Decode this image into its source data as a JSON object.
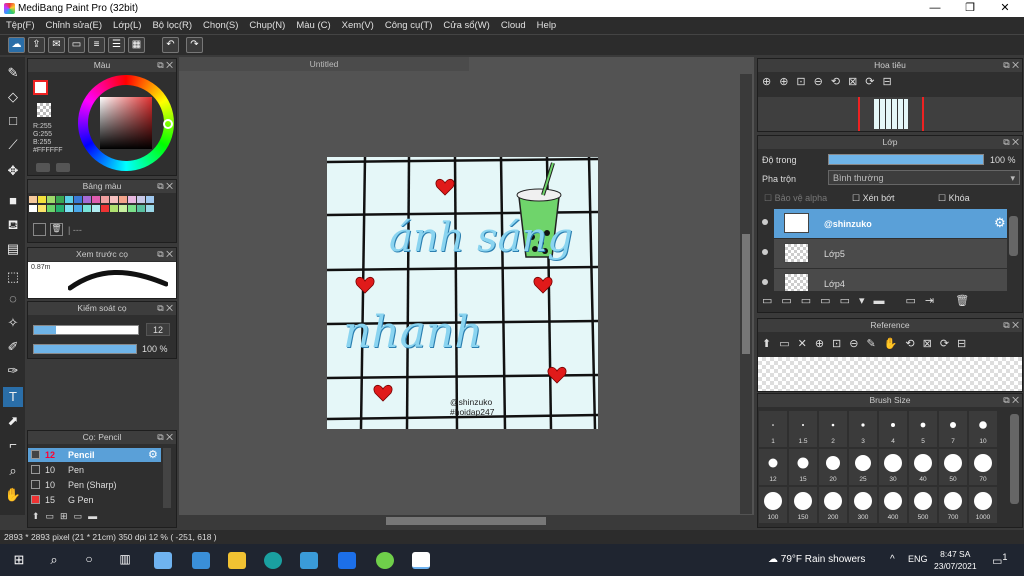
{
  "window": {
    "title": "MediBang Paint Pro (32bit)",
    "min": "—",
    "max": "❐",
    "close": "✕"
  },
  "menu": [
    "Tệp(F)",
    "Chỉnh sửa(E)",
    "Lớp(L)",
    "Bộ lọc(R)",
    "Chọn(S)",
    "Chụp(N)",
    "Màu (C)",
    "Xem(V)",
    "Công cụ(T)",
    "Cửa sổ(W)",
    "Cloud",
    "Help"
  ],
  "color_panel": {
    "title": "Màu",
    "r": "R:255",
    "g": "G:255",
    "b": "B:255",
    "hex": "#FFFFFF"
  },
  "palette_panel": {
    "title": "Bảng màu",
    "dashes": "| ---"
  },
  "preview_panel": {
    "title": "Xem trước cọ",
    "size": "0.87m"
  },
  "control_panel": {
    "title": "Kiểm soát cọ",
    "size_value": "12",
    "opacity_value": "100 %"
  },
  "brush_panel": {
    "title": "Cọ: Pencil",
    "items": [
      {
        "size": "12",
        "name": "Pencil",
        "selected": true
      },
      {
        "size": "10",
        "name": "Pen"
      },
      {
        "size": "10",
        "name": "Pen (Sharp)"
      },
      {
        "size": "15",
        "name": "G Pen"
      }
    ]
  },
  "canvas": {
    "tab": "Untitled",
    "text1": "ánh sáng",
    "text2": "nhanh",
    "sig1": "@shinzuko",
    "sig2": "#hoidap247"
  },
  "navigator": {
    "title": "Hoa tiêu"
  },
  "layer_panel": {
    "title": "Lớp",
    "opacity_label": "Độ trong",
    "opacity_value": "100 %",
    "blend_label": "Pha trộn",
    "blend_value": "Bình thường",
    "protect_alpha": "Bảo vệ alpha",
    "clip": "Xén bớt",
    "lock": "Khóa",
    "layers": [
      {
        "name": "@shinzuko",
        "selected": true
      },
      {
        "name": "Lớp5"
      },
      {
        "name": "Lớp4"
      }
    ]
  },
  "reference_panel": {
    "title": "Reference"
  },
  "brushsize_panel": {
    "title": "Brush Size",
    "sizes": [
      "1",
      "1.5",
      "2",
      "3",
      "4",
      "5",
      "7",
      "10",
      "12",
      "15",
      "20",
      "25",
      "30",
      "40",
      "50",
      "70",
      "100",
      "150",
      "200",
      "300",
      "400",
      "500",
      "700",
      "1000"
    ]
  },
  "status": {
    "text": "2893 * 2893 pixel   (21 * 21cm)   350 dpi   12 %   ( -251, 618 )"
  },
  "taskbar": {
    "weather": "79°F  Rain showers",
    "lang": "ENG",
    "time": "8:47 SA",
    "date": "23/07/2021",
    "notif": "1"
  }
}
